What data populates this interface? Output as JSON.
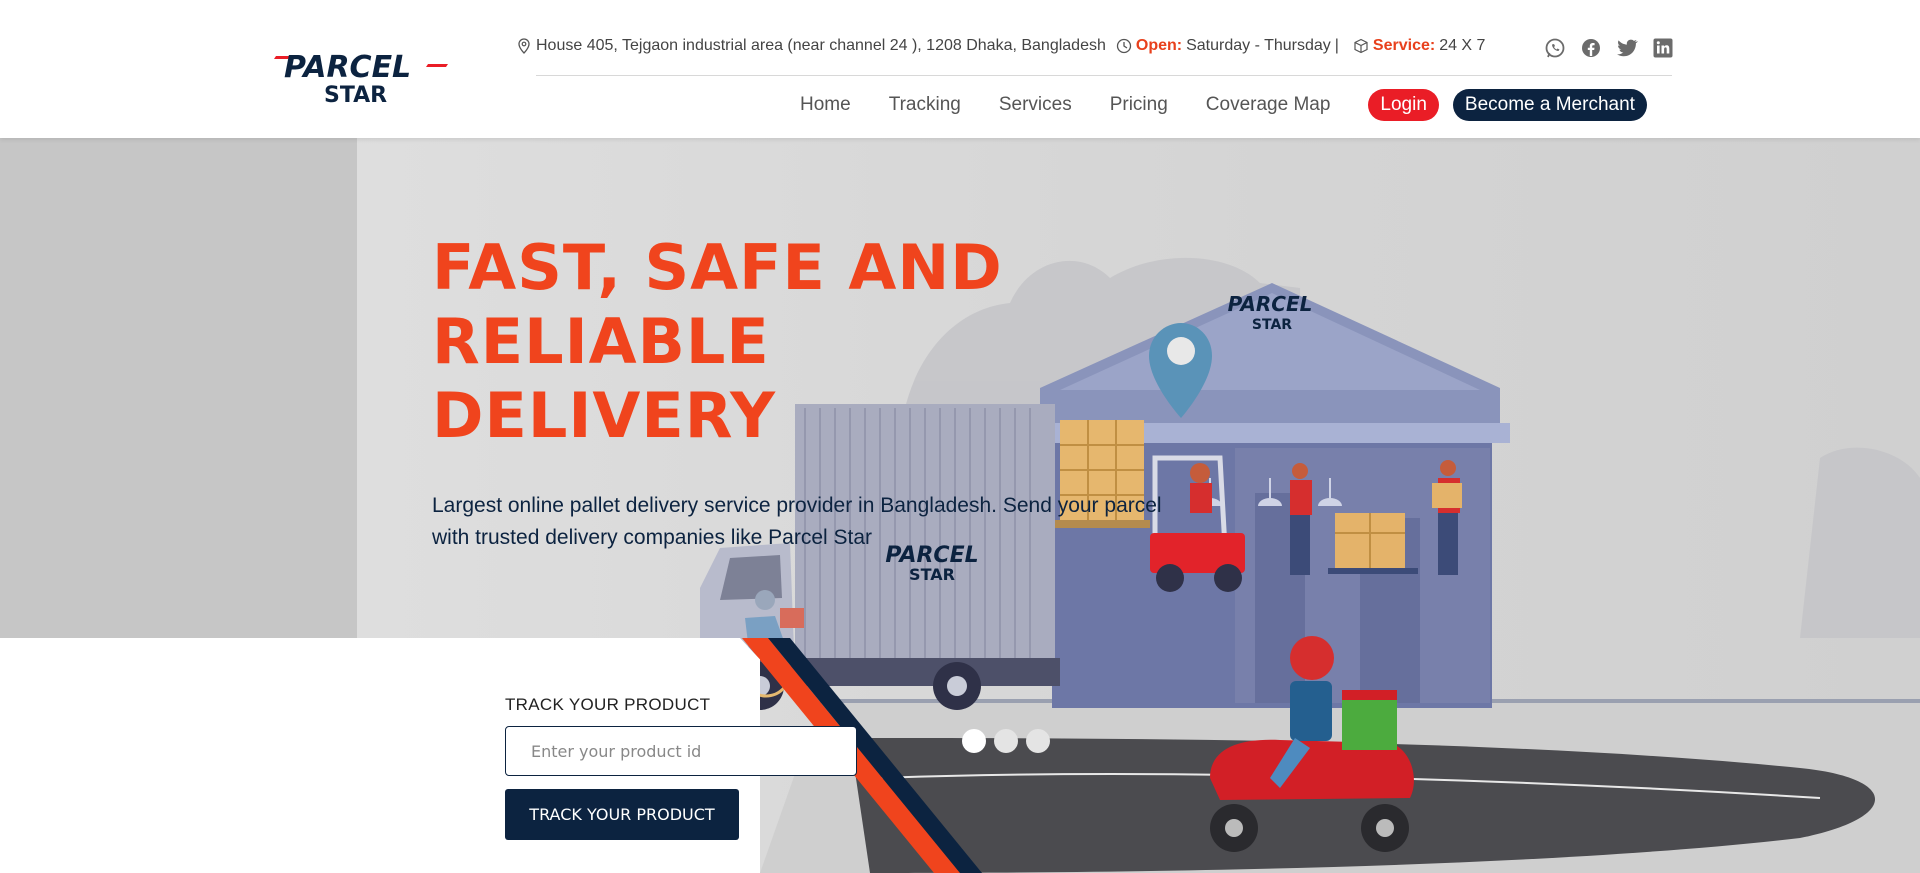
{
  "brand": {
    "logo_line1": "PARCEL",
    "logo_line2": "STAR",
    "primary_color": "#0c2340",
    "accent_color": "#f0441d",
    "login_color": "#ea1d26"
  },
  "topbar": {
    "address_icon": "map-pin-icon",
    "address": "House 405, Tejgaon industrial area (near channel 24 ), 1208 Dhaka, Bangladesh",
    "open_icon": "clock-icon",
    "open_label": "Open:",
    "open_value": "Saturday - Thursday",
    "separator": "|",
    "service_icon": "box-icon",
    "service_label": "Service:",
    "service_value": "24 X 7"
  },
  "socials": [
    "whatsapp-icon",
    "facebook-icon",
    "twitter-icon",
    "linkedin-icon"
  ],
  "nav": {
    "items": [
      "Home",
      "Tracking",
      "Services",
      "Pricing",
      "Coverage Map"
    ],
    "login_label": "Login",
    "merchant_label": "Become a Merchant"
  },
  "hero": {
    "headline_line1": "FAST, SAFE AND",
    "headline_line2": "RELIABLE",
    "headline_line3": "DELIVERY",
    "subtext": "Largest online pallet delivery service provider in Bangladesh. Send your parcel with trusted delivery companies like Parcel Star",
    "truck_logo_line1": "PARCEL",
    "truck_logo_line2": "STAR",
    "warehouse_logo_line1": "PARCEL",
    "warehouse_logo_line2": "STAR"
  },
  "tracking": {
    "label": "TRACK YOUR PRODUCT",
    "placeholder": "Enter your product id",
    "button_label": "TRACK YOUR PRODUCT"
  },
  "carousel": {
    "slide_count": 3,
    "active_slide": 1
  }
}
